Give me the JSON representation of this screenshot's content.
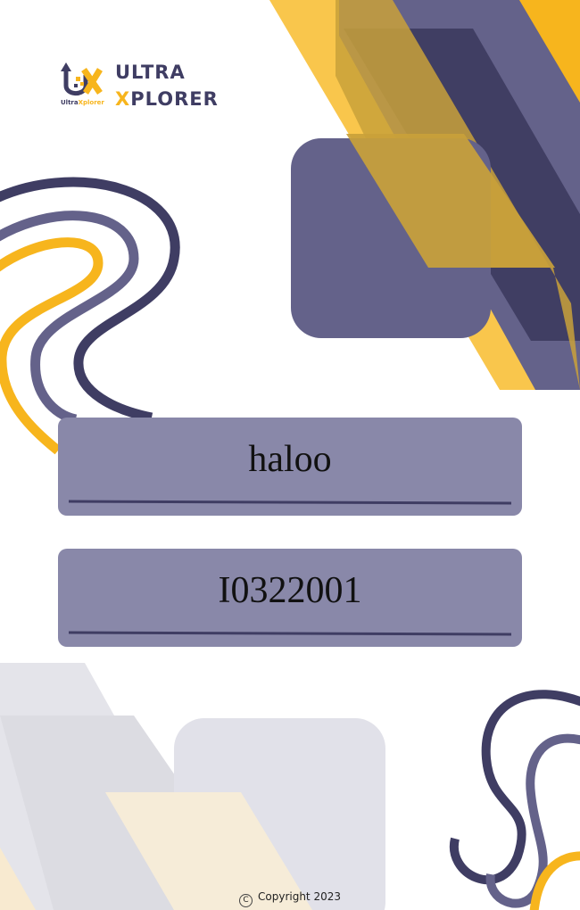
{
  "logo": {
    "line1": "ULTRA",
    "line2_accent": "X",
    "line2_rest": "PLORER",
    "sub_part1": "Ultra",
    "sub_part2": "Xplorer"
  },
  "fields": {
    "name_value": "haloo",
    "id_value": "I0322001"
  },
  "footer": {
    "copyright_symbol": "C",
    "copyright_text": "Copyright 2023"
  },
  "colors": {
    "navy": "#3f3d63",
    "purple": "#64628a",
    "yellow": "#f7b51d",
    "field_bg": "#8988a9"
  }
}
